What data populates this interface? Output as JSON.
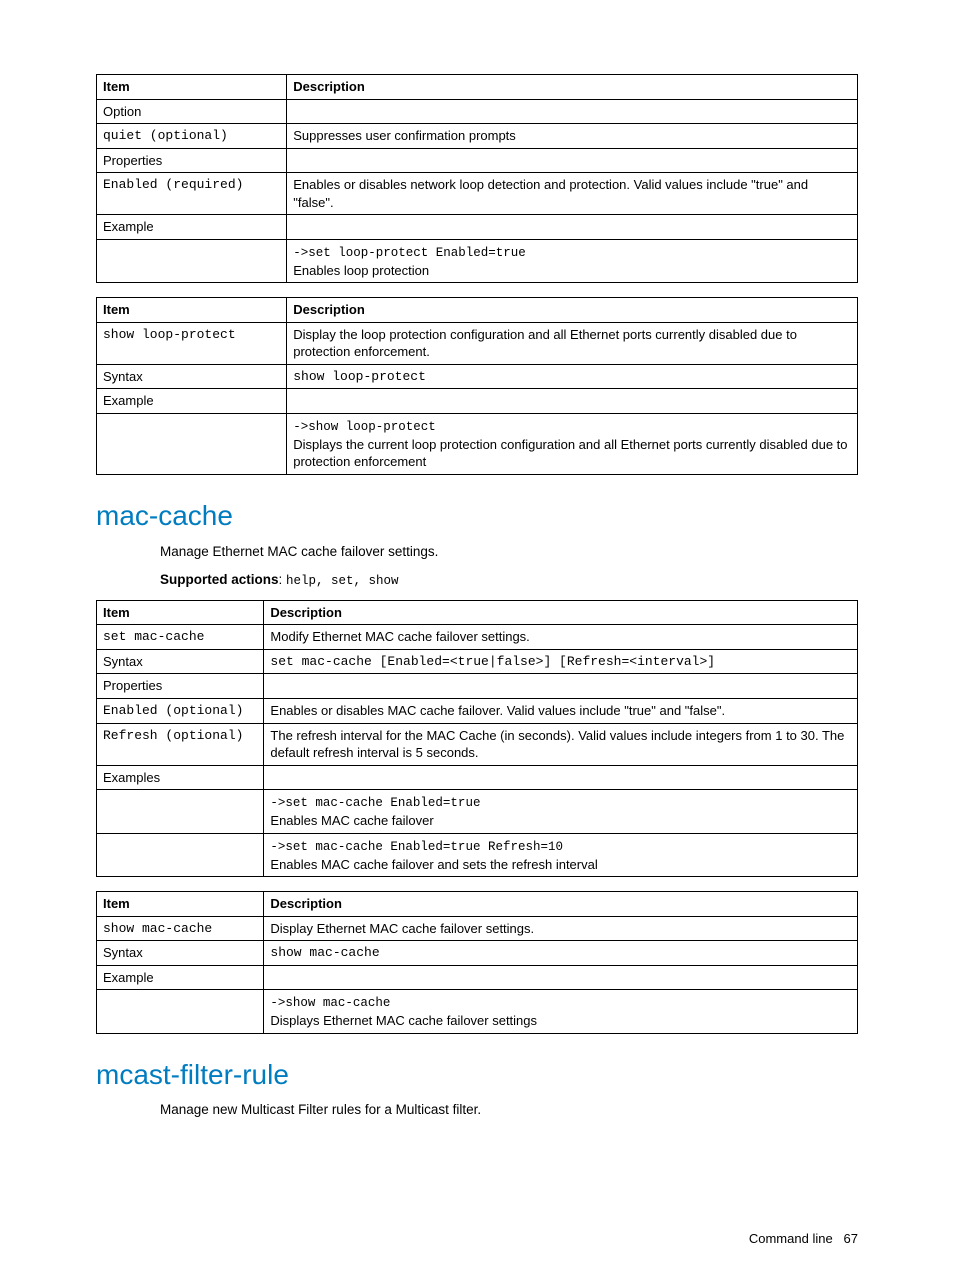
{
  "table1": {
    "headers": {
      "item": "Item",
      "desc": "Description"
    },
    "rows": {
      "option": "Option",
      "quiet_item": "quiet (optional)",
      "quiet_desc": "Suppresses user confirmation prompts",
      "properties": "Properties",
      "enabled_item": "Enabled (required)",
      "enabled_desc": "Enables or disables network loop detection and protection. Valid values include \"true\" and \"false\".",
      "example": "Example",
      "example_cmd": "->set loop-protect Enabled=true",
      "example_desc": "Enables loop protection"
    }
  },
  "table2": {
    "headers": {
      "item": "Item",
      "desc": "Description"
    },
    "rows": {
      "show_item": "show loop-protect",
      "show_desc": "Display the loop protection configuration and all Ethernet ports currently disabled due to protection enforcement.",
      "syntax": "Syntax",
      "syntax_val": "show loop-protect",
      "example": "Example",
      "example_cmd": "->show loop-protect",
      "example_desc": "Displays the current loop protection configuration and all Ethernet ports currently disabled due to protection enforcement"
    }
  },
  "section1": {
    "title": "mac-cache",
    "desc": "Manage Ethernet MAC cache failover settings.",
    "supported_label": "Supported actions",
    "supported_vals": "help, set, show"
  },
  "table3": {
    "headers": {
      "item": "Item",
      "desc": "Description"
    },
    "rows": {
      "set_item": "set mac-cache",
      "set_desc": "Modify Ethernet MAC cache failover settings.",
      "syntax": "Syntax",
      "syntax_val": "set mac-cache [Enabled=<true|false>] [Refresh=<interval>]",
      "properties": "Properties",
      "enabled_item": "Enabled (optional)",
      "enabled_desc": "Enables or disables MAC cache failover. Valid values include \"true\" and \"false\".",
      "refresh_item": "Refresh (optional)",
      "refresh_desc": "The refresh interval for the MAC Cache (in seconds). Valid values include integers from 1 to 30. The default refresh interval is 5 seconds.",
      "examples": "Examples",
      "ex1_cmd": "->set mac-cache Enabled=true",
      "ex1_desc": "Enables MAC cache failover",
      "ex2_cmd": "->set mac-cache Enabled=true Refresh=10",
      "ex2_desc": "Enables MAC cache failover and sets the refresh interval"
    }
  },
  "table4": {
    "headers": {
      "item": "Item",
      "desc": "Description"
    },
    "rows": {
      "show_item": "show mac-cache",
      "show_desc": "Display Ethernet MAC cache failover settings.",
      "syntax": "Syntax",
      "syntax_val": "show mac-cache",
      "example": "Example",
      "example_cmd": "->show mac-cache",
      "example_desc": "Displays Ethernet MAC cache failover settings"
    }
  },
  "section2": {
    "title": "mcast-filter-rule",
    "desc": "Manage new Multicast Filter rules for a Multicast filter."
  },
  "footer": {
    "label": "Command line",
    "page": "67"
  }
}
